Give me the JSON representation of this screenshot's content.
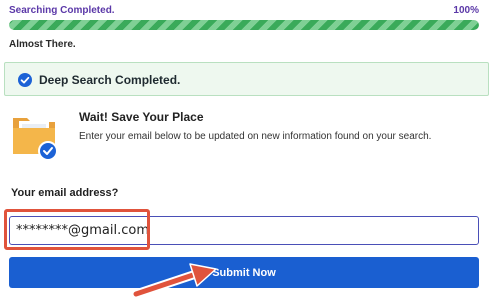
{
  "progress": {
    "title": "Searching Completed.",
    "percent": "100%",
    "value": 1.0,
    "subtitle": "Almost There."
  },
  "banner": {
    "text": "Deep Search Completed.",
    "icon": "check-circle-icon"
  },
  "save_place": {
    "icon": "folder-check-icon",
    "title": "Wait! Save Your Place",
    "description": "Enter your email below to be updated on new information found on your search."
  },
  "email": {
    "label": "Your email address?",
    "value": "********@gmail.com"
  },
  "submit": {
    "label": "Submit Now"
  },
  "annotations": {
    "highlight_color": "#e0533c",
    "arrow_icon": "annotation-arrow-icon"
  },
  "colors": {
    "accent_purple": "#5b38a8",
    "progress_green": "#3aaa5a",
    "button_blue": "#1a5fd1",
    "banner_bg": "#eef8ef"
  }
}
